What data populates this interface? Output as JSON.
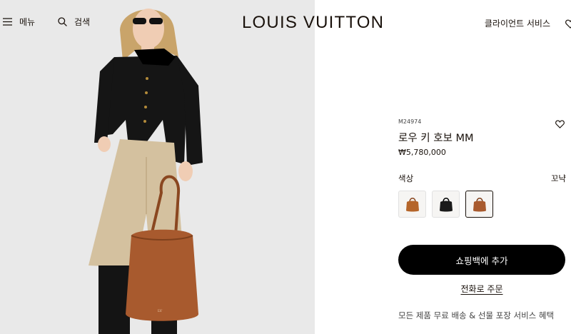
{
  "header": {
    "menu_label": "메뉴",
    "search_label": "검색",
    "logo_text": "LOUIS VUITTON",
    "client_services_label": "클라이언트 서비스"
  },
  "product": {
    "sku": "M24974",
    "name": "로우 키 호보 MM",
    "price": "₩5,780,000",
    "color_label": "색상",
    "color_value": "꼬냑",
    "swatches": [
      {
        "name": "cognac-light",
        "color": "#b5652a",
        "selected": false
      },
      {
        "name": "black",
        "color": "#1a1a1a",
        "selected": false
      },
      {
        "name": "cognac",
        "color": "#a85a2e",
        "selected": true
      }
    ],
    "add_to_bag_label": "쇼핑백에 추가",
    "phone_order_label": "전화로 주문",
    "benefit_text": "모든 제품 무료 배송 & 선물 포장 서비스 혜택"
  },
  "colors": {
    "text": "#19110b",
    "cta_bg": "#000000",
    "hero_bg": "#e9e9e9",
    "bag": "#a85a2e"
  }
}
